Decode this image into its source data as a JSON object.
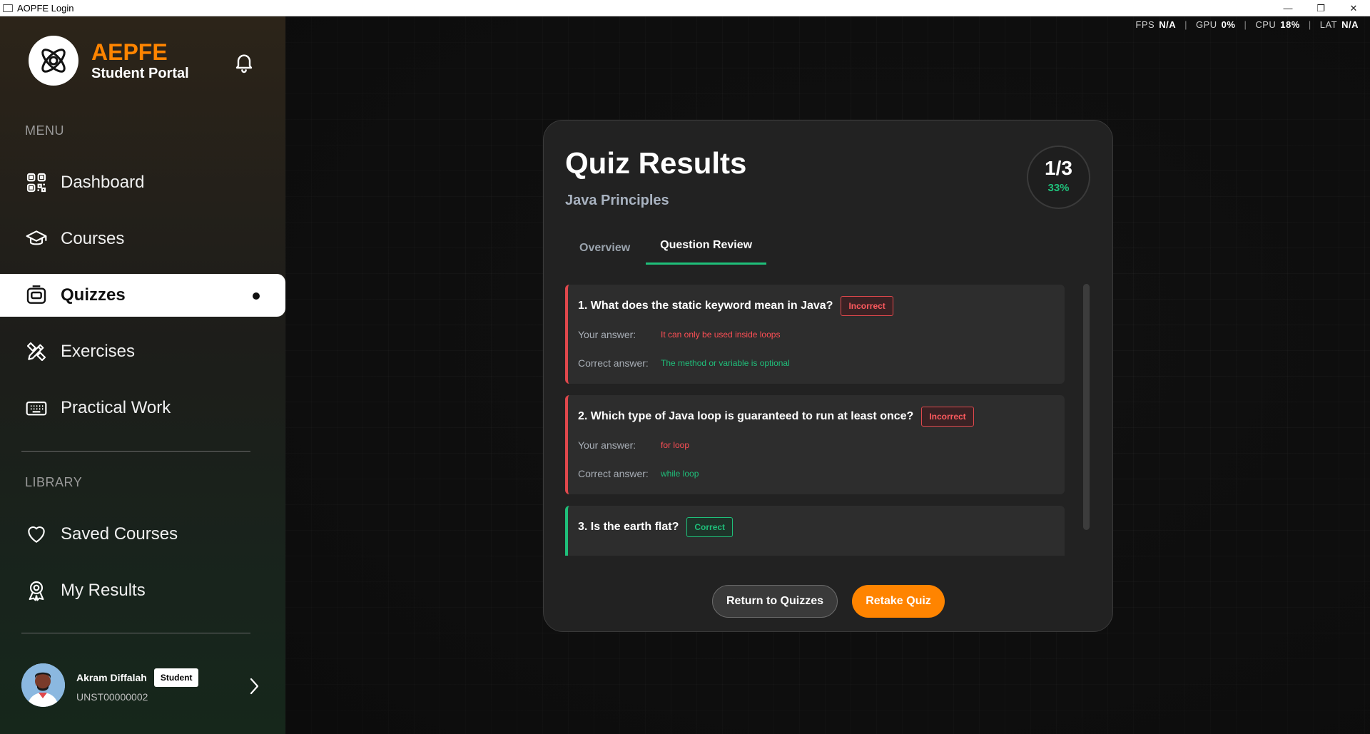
{
  "window": {
    "title": "AOPFE Login"
  },
  "sidebar": {
    "brand_name": "AEPFE",
    "brand_sub": "Student Portal",
    "menu_label": "MENU",
    "library_label": "LIBRARY",
    "items": [
      {
        "label": "Dashboard",
        "icon": "qr-grid-icon"
      },
      {
        "label": "Courses",
        "icon": "graduation-cap-icon"
      },
      {
        "label": "Quizzes",
        "icon": "quiz-icon",
        "active": true
      },
      {
        "label": "Exercises",
        "icon": "pencil-ruler-icon"
      },
      {
        "label": "Practical Work",
        "icon": "keyboard-icon"
      }
    ],
    "library_items": [
      {
        "label": "Saved Courses",
        "icon": "heart-icon"
      },
      {
        "label": "My Results",
        "icon": "award-icon"
      }
    ],
    "user": {
      "name": "Akram Diffalah",
      "role": "Student",
      "id": "UNST00000002"
    }
  },
  "stats": {
    "fps_label": "FPS",
    "fps": "N/A",
    "gpu_label": "GPU",
    "gpu": "0%",
    "cpu_label": "CPU",
    "cpu": "18%",
    "lat_label": "LAT",
    "lat": "N/A"
  },
  "quiz": {
    "title": "Quiz Results",
    "subject": "Java Principles",
    "score_fraction": "1/3",
    "score_percent": "33%",
    "tabs": [
      "Overview",
      "Question Review"
    ],
    "your_answer_label": "Your answer:",
    "correct_answer_label": "Correct answer:",
    "questions": [
      {
        "text": "1. What does the static keyword mean in Java?",
        "status": "Incorrect",
        "your_answer": "It can only be used inside loops",
        "correct_answer": "The method or variable is optional"
      },
      {
        "text": "2. Which type of Java loop is guaranteed to run at least once?",
        "status": "Incorrect",
        "your_answer": "for loop",
        "correct_answer": "while loop"
      },
      {
        "text": "3. Is the earth flat?",
        "status": "Correct"
      }
    ],
    "buttons": {
      "return": "Return to Quizzes",
      "retake": "Retake Quiz"
    }
  },
  "colors": {
    "accent": "#ff8400",
    "success": "#1fbf7a",
    "danger": "#e0484c"
  }
}
